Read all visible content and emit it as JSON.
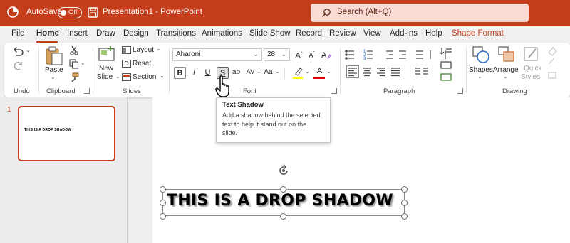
{
  "titlebar": {
    "autosave_label": "AutoSave",
    "autosave_state": "Off",
    "doc_title": "Presentation1  -  PowerPoint",
    "search_placeholder": "Search (Alt+Q)"
  },
  "tabs": [
    {
      "label": "File"
    },
    {
      "label": "Home"
    },
    {
      "label": "Insert"
    },
    {
      "label": "Draw"
    },
    {
      "label": "Design"
    },
    {
      "label": "Transitions"
    },
    {
      "label": "Animations"
    },
    {
      "label": "Slide Show"
    },
    {
      "label": "Record"
    },
    {
      "label": "Review"
    },
    {
      "label": "View"
    },
    {
      "label": "Add-ins"
    },
    {
      "label": "Help"
    },
    {
      "label": "Shape Format"
    }
  ],
  "active_tab": "Home",
  "ribbon": {
    "undo_group_label": "Undo",
    "clipboard": {
      "paste_label": "Paste",
      "group_label": "Clipboard"
    },
    "slides": {
      "new_slide_label_1": "New",
      "new_slide_label_2": "Slide",
      "layout_label": "Layout",
      "reset_label": "Reset",
      "section_label": "Section",
      "group_label": "Slides"
    },
    "font": {
      "font_name": "Aharoni",
      "font_size": "28",
      "bold": "B",
      "italic": "I",
      "underline": "U",
      "shadow": "S",
      "strikethrough": "ab",
      "spacing": "AV",
      "change_case": "Aa",
      "font_color_letter": "A",
      "grow": "A",
      "shrink": "A",
      "group_label": "Font"
    },
    "paragraph": {
      "group_label": "Paragraph"
    },
    "drawing": {
      "shapes_label": "Shapes",
      "arrange_label": "Arrange",
      "quick_styles_label_1": "Quick",
      "quick_styles_label_2": "Styles",
      "group_label": "Drawing"
    }
  },
  "tooltip": {
    "title": "Text Shadow",
    "body_line_1": "Add a shadow behind the selected",
    "body_line_2": "text to help it stand out on the",
    "body_line_3": "slide."
  },
  "thumbnails": [
    {
      "number": "1",
      "text": "THIS IS A DROP SHADOW"
    }
  ],
  "slide": {
    "text": "THIS IS A DROP SHADOW"
  },
  "colors": {
    "accent": "#c43e1c",
    "highlight": "#ffff00",
    "font_color": "#e00000"
  }
}
